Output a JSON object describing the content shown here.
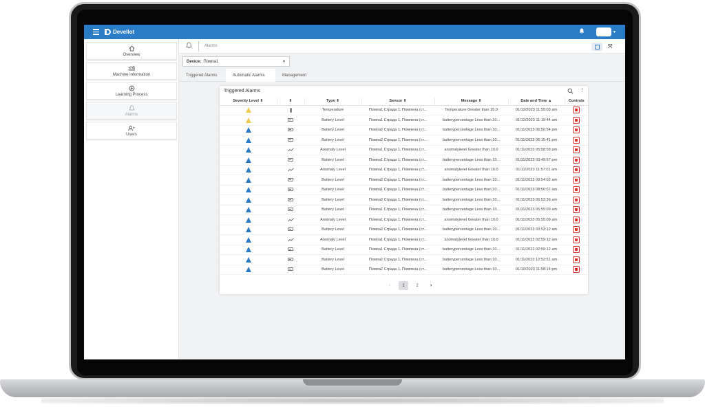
{
  "app": {
    "brand": "DevelIot"
  },
  "sidebar": {
    "items": [
      {
        "label": "Overview",
        "icon": "home-icon"
      },
      {
        "label": "Machine Information",
        "icon": "chart-icon"
      },
      {
        "label": "Learning Process",
        "icon": "brain-icon"
      },
      {
        "label": "Alarms",
        "icon": "bell-icon"
      },
      {
        "label": "Users",
        "icon": "users-icon"
      }
    ]
  },
  "page": {
    "breadcrumb": "Alarms"
  },
  "device": {
    "label": "Device:",
    "value": "Помпа1"
  },
  "tabs": [
    {
      "label": "Triggered Alarms"
    },
    {
      "label": "Automatic Alarms"
    },
    {
      "label": "Management"
    }
  ],
  "card": {
    "title": "Triggered Alarms",
    "columns": [
      "Severity Level ⇕",
      "⇕",
      "Type ⇕",
      "Sensor ⇕",
      "Message ⇕",
      "Date and Time ▲",
      "Controls"
    ]
  },
  "colors": {
    "accent": "#2b7cc7",
    "warning": "#f2c94c",
    "danger": "#d9302b"
  },
  "rows": [
    {
      "severity": "yellow",
      "icon": "thermometer-icon",
      "type": "Temperature",
      "sensor": "Помпа1 Сграда 1, Помпена (ст...",
      "message": "Temperature Greater than 15.0",
      "datetime": "01/12/2023 11:55:03 am"
    },
    {
      "severity": "yellow",
      "icon": "battery-icon",
      "type": "Battery Level",
      "sensor": "Помпа1 Сграда 1, Помпена (ст...",
      "message": "batterypercentage Less than 10...",
      "datetime": "01/12/2023 11:19:44 am"
    },
    {
      "severity": "blue",
      "icon": "battery-icon",
      "type": "Battery Level",
      "sensor": "Помпа2 Сграда 1, Помпена (ст...",
      "message": "batterypercentage Less than 10...",
      "datetime": "01/11/2023 06:50:54 pm"
    },
    {
      "severity": "blue",
      "icon": "battery-icon",
      "type": "Battery Level",
      "sensor": "Помпа2 Сграда 1, Помпена (ст...",
      "message": "batterypercentage Less than 10...",
      "datetime": "01/11/2023 06:15:41 pm"
    },
    {
      "severity": "blue",
      "icon": "trend-icon",
      "type": "Anomaly Level",
      "sensor": "Помпа1 Сграда 1, Помпена (ст...",
      "message": "anomalylevel Greater than 10.0",
      "datetime": "01/11/2023 05:58:58 pm"
    },
    {
      "severity": "blue",
      "icon": "battery-icon",
      "type": "Battery Level",
      "sensor": "Помпа1 Сграда 1, Помпена (ст...",
      "message": "batterypercentage Less than 10...",
      "datetime": "01/11/2023 03:49:57 pm"
    },
    {
      "severity": "blue",
      "icon": "trend-icon",
      "type": "Anomaly Level",
      "sensor": "Помпа1 Сграда 1, Помпена (ст...",
      "message": "anomalylevel Greater than 10.0",
      "datetime": "01/11/2023 11:57:01 am"
    },
    {
      "severity": "blue",
      "icon": "battery-icon",
      "type": "Battery Level",
      "sensor": "Помпа2 Сграда 1, Помпена (ст...",
      "message": "batterypercentage Less than 10...",
      "datetime": "01/11/2023 09:54:02 am"
    },
    {
      "severity": "blue",
      "icon": "battery-icon",
      "type": "Battery Level",
      "sensor": "Помпа1 Сграда 1, Помпена (ст...",
      "message": "batterypercentage Less than 10...",
      "datetime": "01/11/2023 08:56:07 am"
    },
    {
      "severity": "blue",
      "icon": "battery-icon",
      "type": "Battery Level",
      "sensor": "Помпа2 Сграда 1, Помпена (ст...",
      "message": "batterypercentage Less than 10...",
      "datetime": "01/11/2023 06:53:36 am"
    },
    {
      "severity": "blue",
      "icon": "battery-icon",
      "type": "Battery Level",
      "sensor": "Помпа1 Сграда 1, Помпена (ст...",
      "message": "batterypercentage Less than 10...",
      "datetime": "01/11/2023 05:55:09 am"
    },
    {
      "severity": "blue",
      "icon": "trend-icon",
      "type": "Anomaly Level",
      "sensor": "Помпа1 Сграда 1, Помпена (ст...",
      "message": "anomalylevel Greater than 10.0",
      "datetime": "01/11/2023 05:55:09 am"
    },
    {
      "severity": "blue",
      "icon": "battery-icon",
      "type": "Battery Level",
      "sensor": "Помпа2 Сграда 1, Помпена (ст...",
      "message": "batterypercentage Less than 10...",
      "datetime": "01/11/2023 03:53:12 am"
    },
    {
      "severity": "blue",
      "icon": "trend-icon",
      "type": "Anomaly Level",
      "sensor": "Помпа1 Сграда 1, Помпена (ст...",
      "message": "anomalylevel Greater than 10.0",
      "datetime": "01/11/2023 02:59:12 am"
    },
    {
      "severity": "blue",
      "icon": "battery-icon",
      "type": "Battery Level",
      "sensor": "Помпа1 Сграда 1, Помпена (ст...",
      "message": "batterypercentage Less than 10...",
      "datetime": "01/11/2023 02:59:12 am"
    },
    {
      "severity": "blue",
      "icon": "battery-icon",
      "type": "Battery Level",
      "sensor": "Помпа2 Сграда 1, Помпена (ст...",
      "message": "batterypercentage Less than 10...",
      "datetime": "01/11/2023 12:52:51 am"
    },
    {
      "severity": "blue",
      "icon": "battery-icon",
      "type": "Battery Level",
      "sensor": "Помпа2 Сграда 1, Помпена (ст...",
      "message": "batterypercentage Less than 10...",
      "datetime": "01/10/2023 11:58:14 pm"
    }
  ],
  "pagination": {
    "prev": "‹",
    "pages": [
      "1",
      "2"
    ],
    "current": "1",
    "next": "›"
  }
}
